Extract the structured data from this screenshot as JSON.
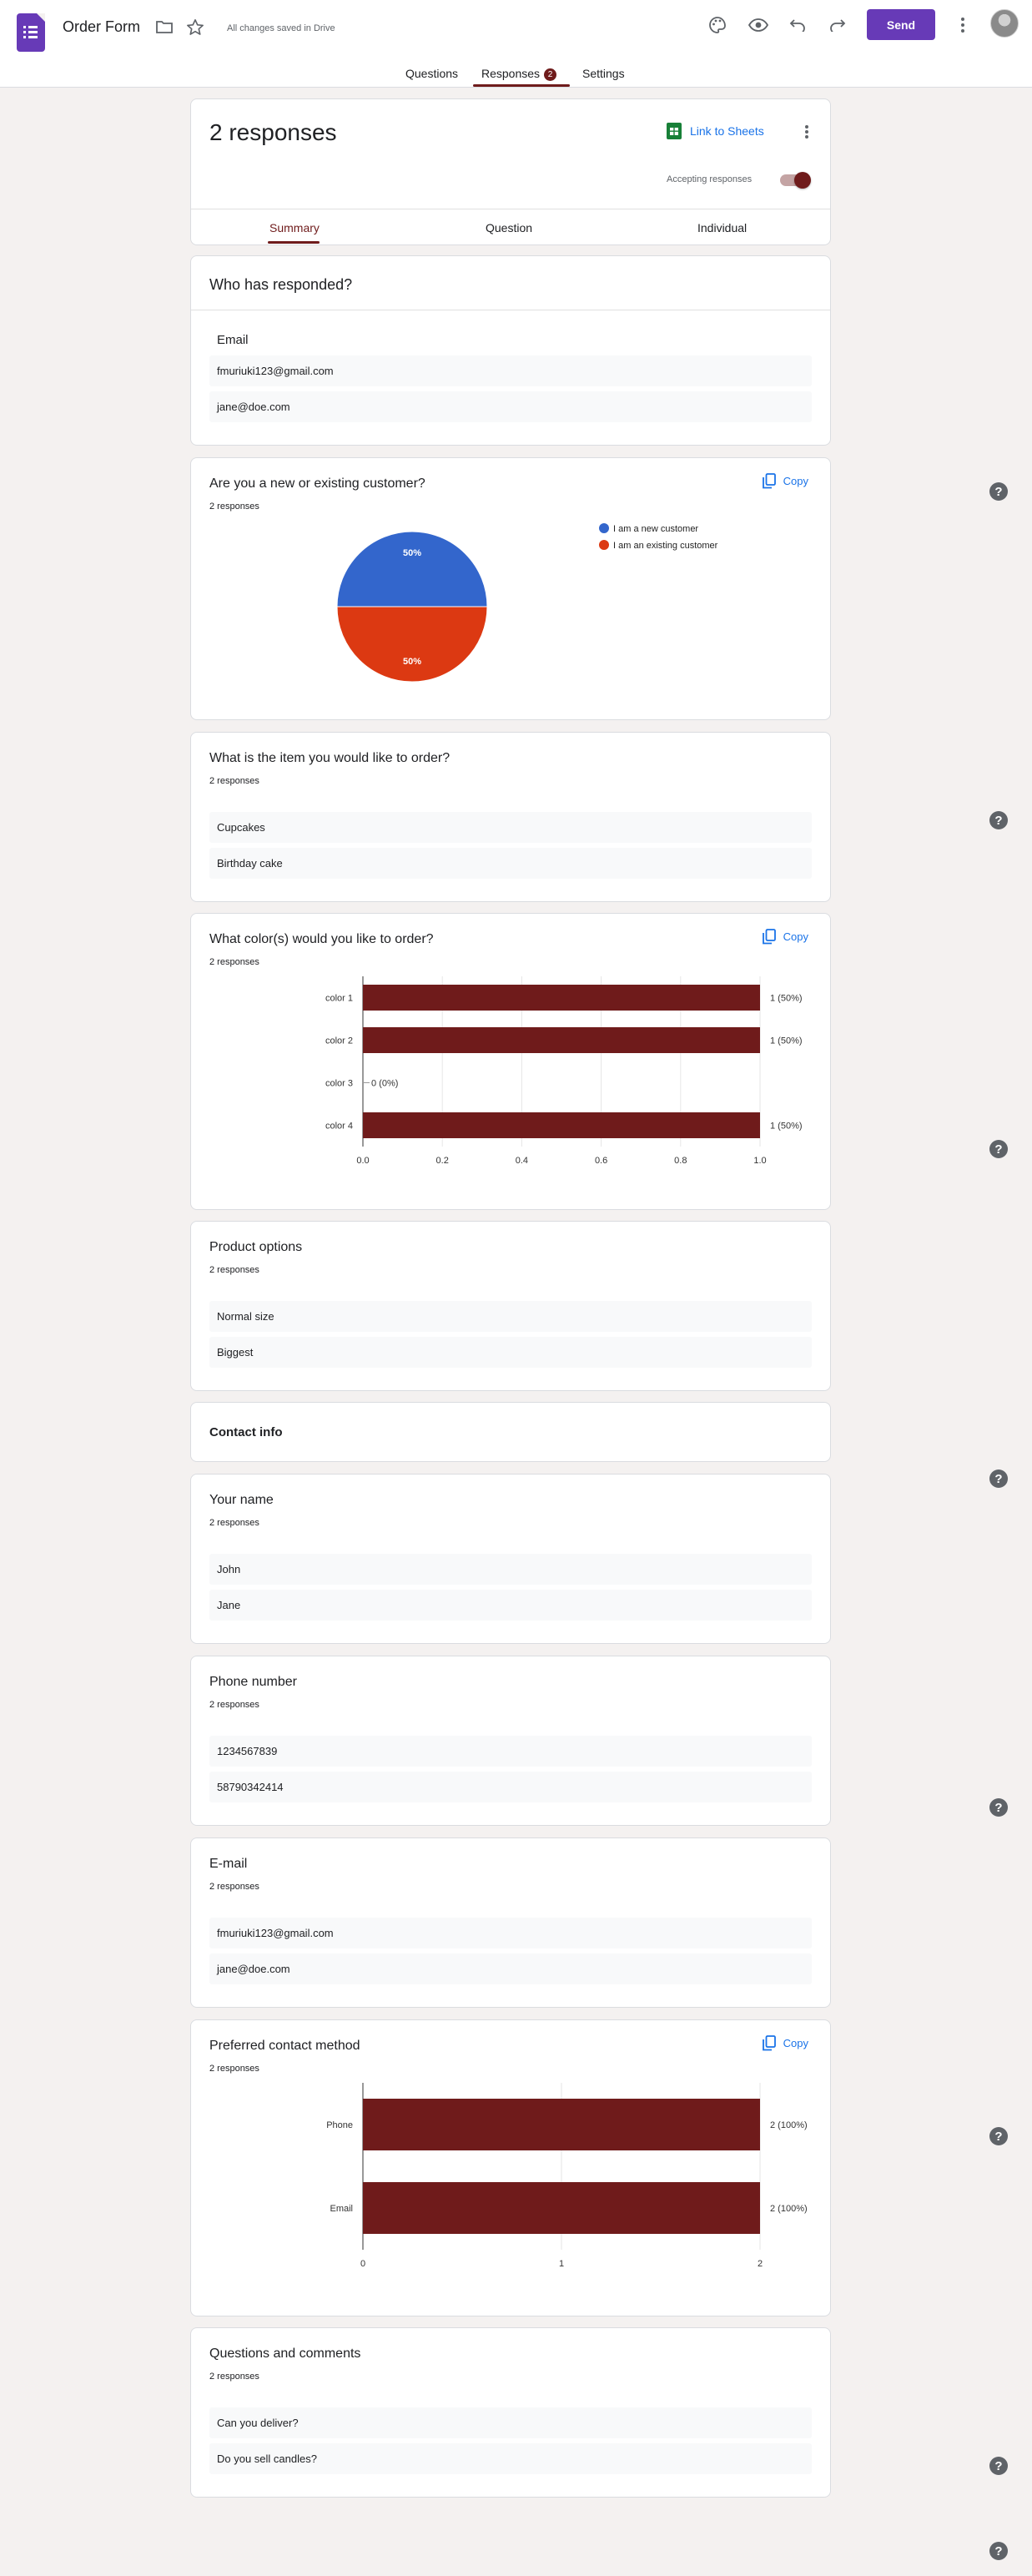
{
  "header": {
    "title": "Order Form",
    "saved_status": "All changes saved in Drive",
    "send_label": "Send",
    "tabs": [
      {
        "label": "Questions"
      },
      {
        "label": "Responses",
        "badge": "2"
      },
      {
        "label": "Settings"
      }
    ]
  },
  "summary_card": {
    "heading": "2 responses",
    "link_sheets": "Link to Sheets",
    "accepting_label": "Accepting responses",
    "accepting": true,
    "subtabs": [
      "Summary",
      "Question",
      "Individual"
    ]
  },
  "who_card": {
    "title": "Who has responded?",
    "email_label": "Email",
    "emails": [
      "fmuriuki123@gmail.com",
      "jane@doe.com"
    ]
  },
  "copy_label": "Copy",
  "q_customer": {
    "title": "Are you a new or existing customer?",
    "count": "2 responses"
  },
  "q_item": {
    "title": "What is the item you would like to order?",
    "count": "2 responses",
    "answers": [
      "Cupcakes",
      "Birthday cake"
    ]
  },
  "q_colors": {
    "title": "What color(s) would you like to order?",
    "count": "2 responses"
  },
  "q_product": {
    "title": "Product options",
    "count": "2 responses",
    "answers": [
      "Normal size",
      "Biggest"
    ]
  },
  "section_contact": {
    "title": "Contact info"
  },
  "q_name": {
    "title": "Your name",
    "count": "2 responses",
    "answers": [
      "John",
      "Jane"
    ]
  },
  "q_phone": {
    "title": "Phone number",
    "count": "2 responses",
    "answers": [
      "1234567839",
      "58790342414"
    ]
  },
  "q_email": {
    "title": "E-mail",
    "count": "2 responses",
    "answers": [
      "fmuriuki123@gmail.com",
      "jane@doe.com"
    ]
  },
  "q_contact_method": {
    "title": "Preferred contact method",
    "count": "2 responses"
  },
  "q_comments": {
    "title": "Questions and comments",
    "count": "2 responses",
    "answers": [
      "Can you deliver?",
      "Do you sell candles?"
    ]
  },
  "chart_data": [
    {
      "type": "pie",
      "categories": [
        "I am a new customer",
        "I am an existing customer"
      ],
      "values": [
        50,
        50
      ],
      "value_labels": [
        "50%",
        "50%"
      ],
      "colors": [
        "#3366cc",
        "#dc3912"
      ],
      "legend": "right"
    },
    {
      "type": "bar",
      "orientation": "horizontal",
      "categories": [
        "color 1",
        "color 2",
        "color 3",
        "color 4"
      ],
      "values": [
        1,
        1,
        0,
        1
      ],
      "value_labels": [
        "1 (50%)",
        "1 (50%)",
        "0 (0%)",
        "1 (50%)"
      ],
      "xlim": [
        0,
        1
      ],
      "ticks": [
        "0.0",
        "0.2",
        "0.4",
        "0.6",
        "0.8",
        "1.0"
      ],
      "color": "#6f1b1b"
    },
    {
      "type": "bar",
      "orientation": "horizontal",
      "categories": [
        "Phone",
        "Email"
      ],
      "values": [
        2,
        2
      ],
      "value_labels": [
        "2 (100%)",
        "2 (100%)"
      ],
      "xlim": [
        0,
        2
      ],
      "ticks": [
        "0",
        "1",
        "2"
      ],
      "color": "#6f1b1b"
    }
  ]
}
